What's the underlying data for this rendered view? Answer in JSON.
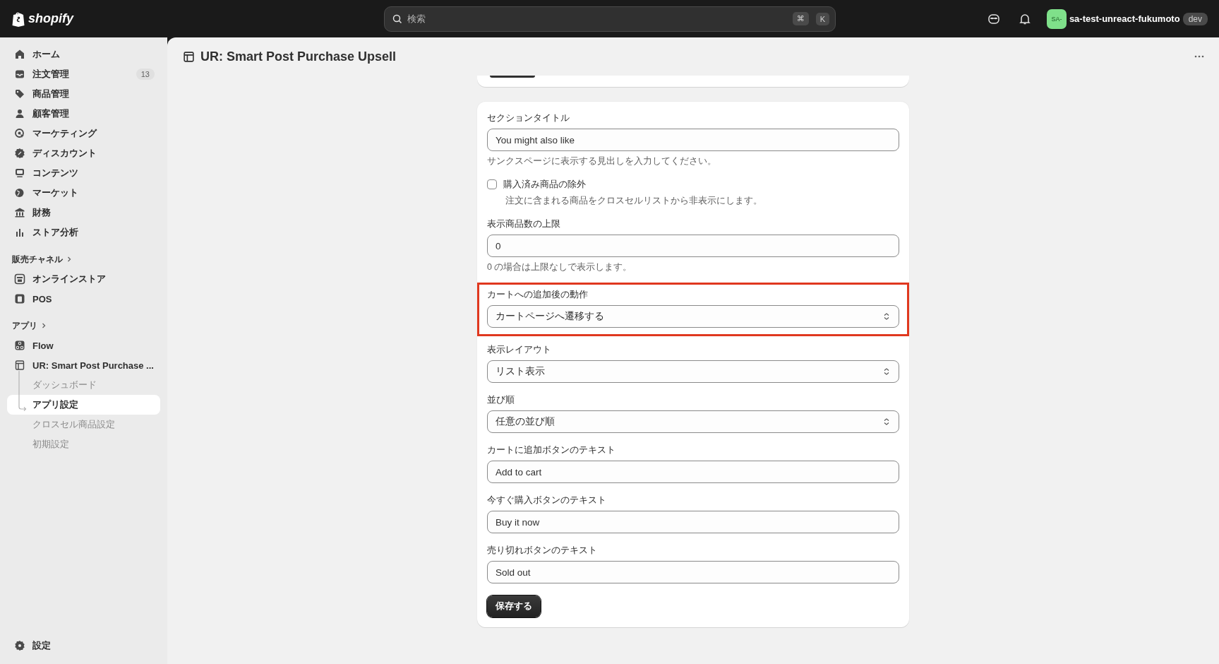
{
  "topbar": {
    "logo": "shopify",
    "search": {
      "placeholder": "検索",
      "shortcut": [
        "⌘",
        "K"
      ]
    },
    "store": {
      "avatar": "SA-",
      "name": "sa-test-unreact-fukumoto",
      "badge": "dev"
    }
  },
  "sidebar": {
    "items": [
      {
        "label": "ホーム",
        "selected": false
      },
      {
        "label": "注文管理",
        "badge": "13",
        "selected": false
      },
      {
        "label": "商品管理",
        "selected": false
      },
      {
        "label": "顧客管理",
        "selected": false
      },
      {
        "label": "マーケティング",
        "selected": false
      },
      {
        "label": "ディスカウント",
        "selected": false
      },
      {
        "label": "コンテンツ",
        "selected": false
      },
      {
        "label": "マーケット",
        "selected": false
      },
      {
        "label": "財務",
        "selected": false
      },
      {
        "label": "ストア分析",
        "selected": false
      }
    ],
    "sections": [
      {
        "title": "販売チャネル",
        "items": [
          {
            "label": "オンラインストア",
            "selected": false
          },
          {
            "label": "POS",
            "selected": false
          }
        ]
      },
      {
        "title": "アプリ",
        "items": [
          {
            "label": "Flow",
            "selected": false
          },
          {
            "label": "UR: Smart Post Purchase ...",
            "selected": false,
            "children": [
              {
                "label": "ダッシュボード",
                "selected": false
              },
              {
                "label": "アプリ設定",
                "selected": true
              },
              {
                "label": "クロスセル商品設定",
                "selected": false
              },
              {
                "label": "初期設定",
                "selected": false
              }
            ]
          }
        ]
      }
    ],
    "settings": "設定"
  },
  "page": {
    "title": "UR: Smart Post Purchase Upsell"
  },
  "form": {
    "fields": [
      {
        "kind": "text",
        "label": "セクションタイトル",
        "value": "You might also like",
        "help": "サンクスページに表示する見出しを入力してください。",
        "highlighted": false
      },
      {
        "kind": "checkbox",
        "label": "購入済み商品の除外",
        "checked": false,
        "help": "注文に含まれる商品をクロスセルリストから非表示にします。",
        "highlighted": false
      },
      {
        "kind": "text",
        "label": "表示商品数の上限",
        "value": "0",
        "help": "0 の場合は上限なしで表示します。",
        "highlighted": false
      },
      {
        "kind": "select",
        "label": "カートへの追加後の動作",
        "value": "カートページへ遷移する",
        "highlighted": true
      },
      {
        "kind": "select",
        "label": "表示レイアウト",
        "value": "リスト表示",
        "highlighted": false
      },
      {
        "kind": "select",
        "label": "並び順",
        "value": "任意の並び順",
        "highlighted": false
      },
      {
        "kind": "text",
        "label": "カートに追加ボタンのテキスト",
        "value": "Add to cart",
        "highlighted": false
      },
      {
        "kind": "text",
        "label": "今すぐ購入ボタンのテキスト",
        "value": "Buy it now",
        "highlighted": false
      },
      {
        "kind": "text",
        "label": "売り切れボタンのテキスト",
        "value": "Sold out",
        "highlighted": false
      }
    ],
    "save_button": "保存する"
  }
}
